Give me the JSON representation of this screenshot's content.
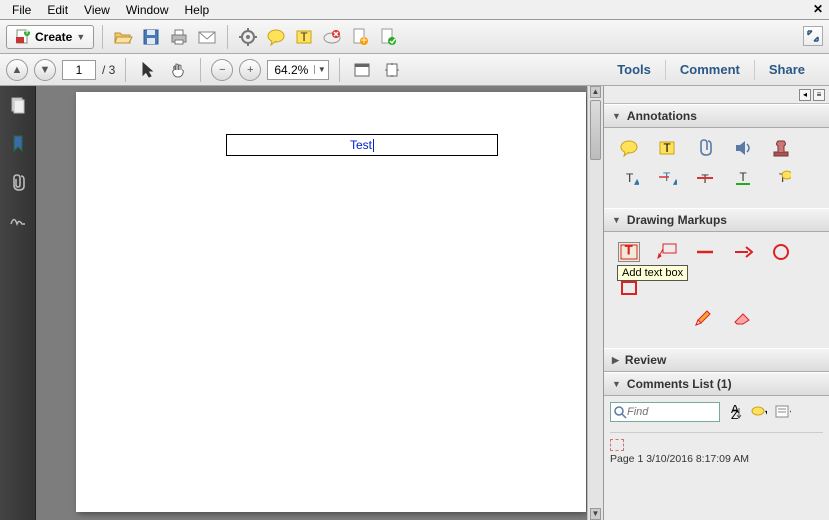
{
  "menu": {
    "items": [
      "File",
      "Edit",
      "View",
      "Window",
      "Help"
    ]
  },
  "toolbar1": {
    "create_label": "Create"
  },
  "toolbar2": {
    "current_page": "1",
    "page_total": "/ 3",
    "zoom": "64.2%"
  },
  "right_links": {
    "tools": "Tools",
    "comment": "Comment",
    "share": "Share"
  },
  "document": {
    "textbox_value": "Test"
  },
  "panels": {
    "annotations": {
      "title": "Annotations"
    },
    "drawing": {
      "title": "Drawing Markups",
      "tooltip": "Add text box"
    },
    "review": {
      "title": "Review"
    },
    "comments_list": {
      "title": "Comments List (1)",
      "find_placeholder": "Find",
      "item_meta": "Page 1  3/10/2016 8:17:09 AM"
    }
  }
}
